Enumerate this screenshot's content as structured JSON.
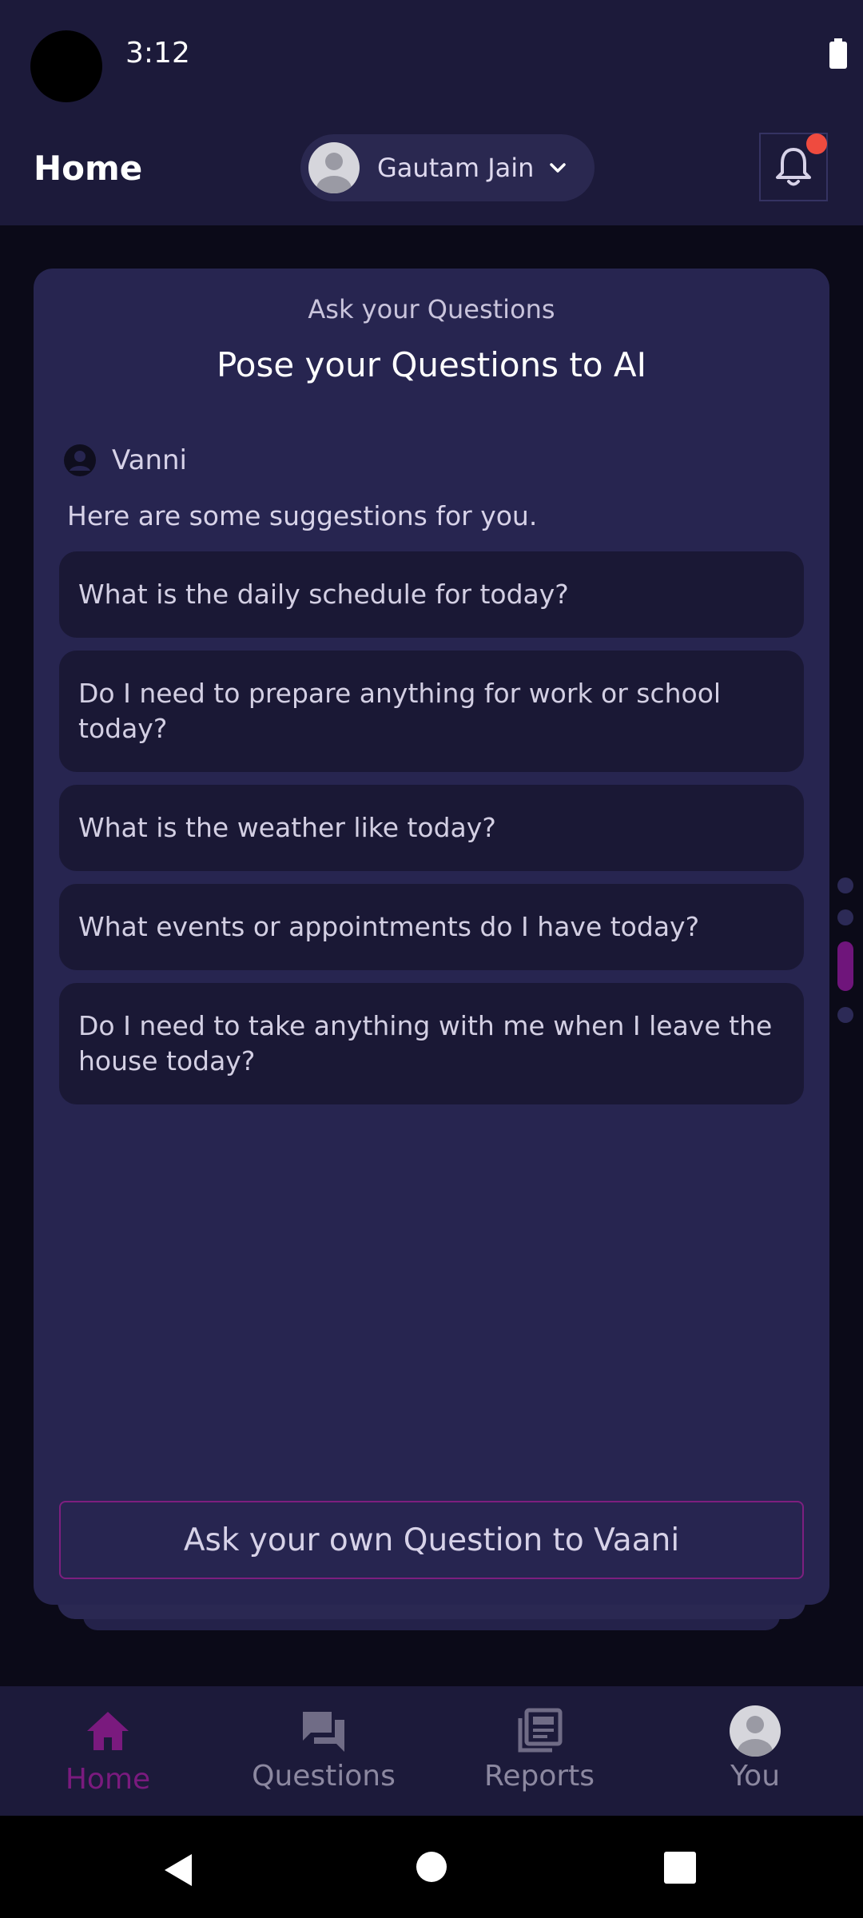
{
  "status_bar": {
    "time": "3:12",
    "battery_icon": "battery-full-icon"
  },
  "app_bar": {
    "title": "Home",
    "user_name": "Gautam Jain",
    "dropdown_icon": "chevron-down-icon",
    "notification_icon": "bell-icon",
    "notification_dot_color": "#ef4b3f"
  },
  "card": {
    "subtitle": "Ask your Questions",
    "title": "Pose your Questions to AI",
    "assistant_name": "Vanni",
    "intro": "Here are some suggestions for you.",
    "suggestions": [
      "What is the daily schedule for today?",
      "Do I need to prepare anything for work or school today?",
      "What is the weather like today?",
      "What events or appointments do I have today?",
      "Do I need to take anything with me when I leave the house today?"
    ],
    "ask_button": "Ask your own Question to Vaani"
  },
  "pager": {
    "count": 4,
    "active_index": 2
  },
  "bottom_nav": {
    "items": [
      {
        "label": "Home",
        "icon": "home-icon",
        "active": true
      },
      {
        "label": "Questions",
        "icon": "chat-icon",
        "active": false
      },
      {
        "label": "Reports",
        "icon": "news-icon",
        "active": false
      },
      {
        "label": "You",
        "icon": "avatar-icon",
        "active": false
      }
    ]
  },
  "colors": {
    "background": "#0b0a18",
    "bar": "#1c1a3a",
    "card": "#272550",
    "suggestion": "#1a1835",
    "accent": "#7a1a7e"
  }
}
